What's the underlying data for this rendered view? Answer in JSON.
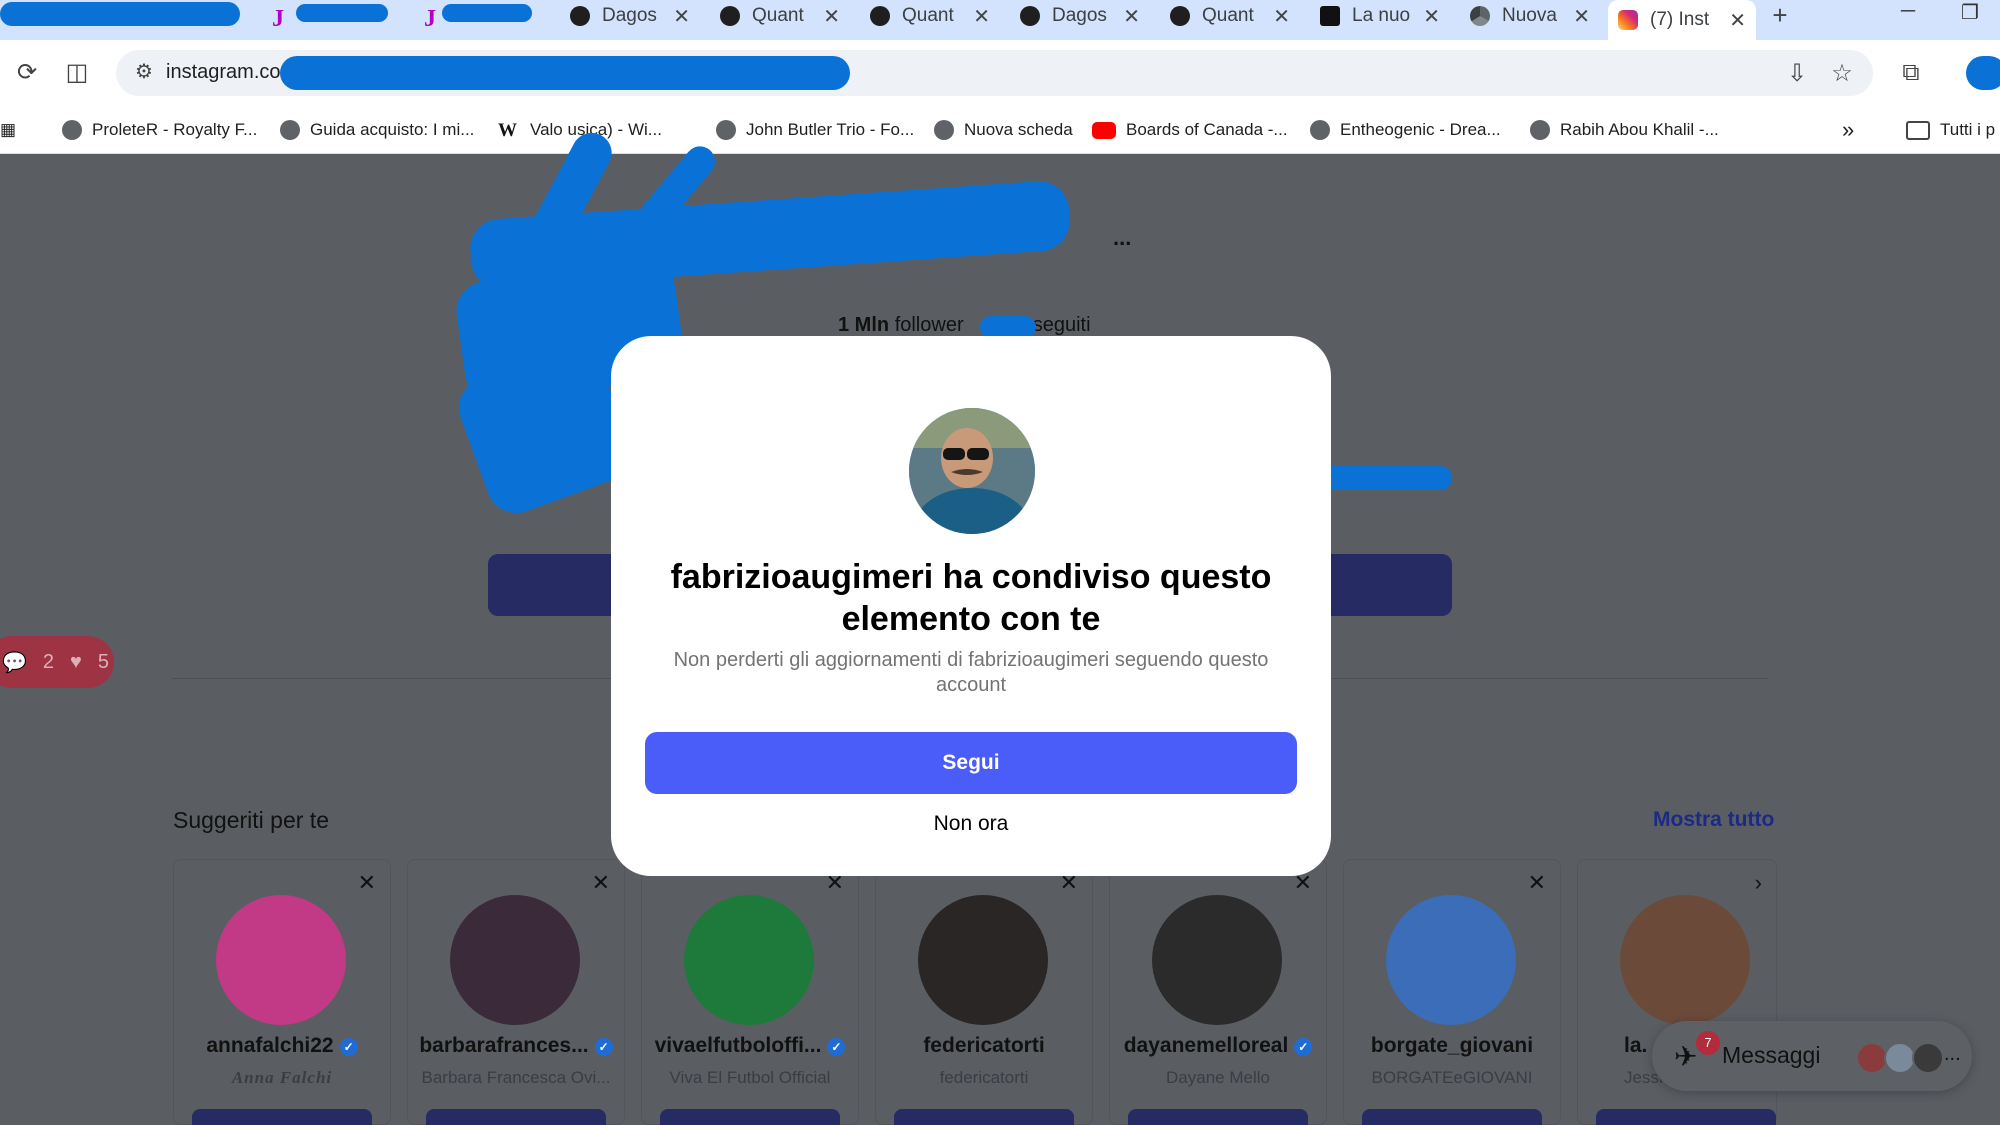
{
  "browser": {
    "tabs": [
      {
        "icon": "joomla-icon",
        "label": ""
      },
      {
        "icon": "joomla-icon",
        "label": ""
      },
      {
        "icon": "dagospia-icon",
        "label": "Dagos"
      },
      {
        "icon": "dagospia-icon",
        "label": "Quant"
      },
      {
        "icon": "dagospia-icon",
        "label": "Quant"
      },
      {
        "icon": "dagospia-icon",
        "label": "Dagos"
      },
      {
        "icon": "dagospia-icon",
        "label": "Quant"
      },
      {
        "icon": "corriere-icon",
        "label": "La nuo"
      },
      {
        "icon": "chrome-icon",
        "label": "Nuova"
      },
      {
        "icon": "instagram-icon",
        "label": "(7) Inst"
      }
    ],
    "url": "instagram.co",
    "bookmarks": [
      {
        "icon": "globe-icon",
        "label": "ProleteR - Royalty F..."
      },
      {
        "icon": "globe-icon",
        "label": "Guida acquisto: I mi..."
      },
      {
        "icon": "wikipedia-icon",
        "label": "Valo     usica) - Wi..."
      },
      {
        "icon": "globe-icon",
        "label": "John Butler Trio - Fo..."
      },
      {
        "icon": "chrome-icon",
        "label": "Nuova scheda"
      },
      {
        "icon": "youtube-icon",
        "label": "Boards of Canada -..."
      },
      {
        "icon": "globe-icon",
        "label": "Entheogenic - Drea..."
      },
      {
        "icon": "globe-icon",
        "label": "Rabih Abou Khalil -..."
      }
    ],
    "bookmarks_overflow": "»",
    "all_bookmarks": "Tutti i p"
  },
  "profile": {
    "followers_count": "1 Mln",
    "followers_label": "follower",
    "following_label": "seguiti",
    "more": "..."
  },
  "notifications": {
    "comments": "2",
    "likes": "5"
  },
  "suggestions": {
    "title": "Suggeriti per te",
    "show_all": "Mostra tutto",
    "cards": [
      {
        "username": "annafalchi22",
        "verified": true,
        "full_name": "Anna Falchi",
        "color": "#c23a86"
      },
      {
        "username": "barbarafrances...",
        "verified": true,
        "full_name": "Barbara Francesca Ovi...",
        "color": "#3a2a3a"
      },
      {
        "username": "vivaelfutboloffi...",
        "verified": true,
        "full_name": "Viva El Futbol Official",
        "color": "#1e7a3a"
      },
      {
        "username": "federicatorti",
        "verified": false,
        "full_name": "federicatorti",
        "color": "#2a2626"
      },
      {
        "username": "dayanemelloreal",
        "verified": true,
        "full_name": "Dayane Mello",
        "color": "#2b2b2b"
      },
      {
        "username": "borgate_giovani",
        "verified": false,
        "full_name": "BORGATEeGIOVANI",
        "color": "#3b6db8"
      },
      {
        "username": "la.",
        "verified": false,
        "full_name": "Jessic",
        "color": "#6b4a3a"
      }
    ]
  },
  "messages": {
    "label": "Messaggi",
    "badge": "7",
    "more": "..."
  },
  "modal": {
    "title": "fabrizioaugimeri ha condiviso questo elemento con te",
    "subtitle": "Non perderti gli aggiornamenti di fabrizioaugimeri seguendo questo account",
    "follow_label": "Segui",
    "not_now_label": "Non ora"
  }
}
